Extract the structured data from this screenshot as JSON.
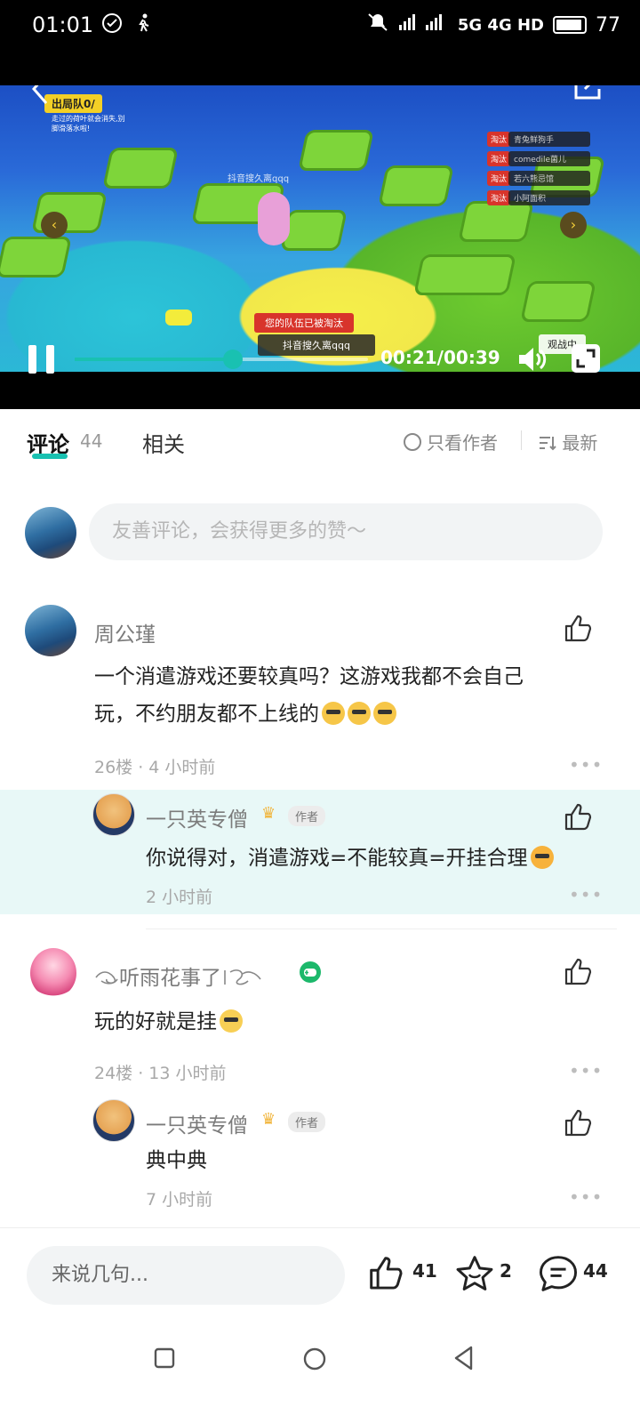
{
  "status_bar": {
    "time": "01:01",
    "network": "5G 4G HD",
    "battery": "77"
  },
  "video": {
    "team_label": "出局队0/",
    "team_note": "走过的荷叶就会消失,别脚滑落水啦!",
    "watermark": "抖音搜久离qqq",
    "eliminated_banner": "您的队伍已被淘汰",
    "search_banner": "抖音搜久离qqq",
    "spectating": "观战中",
    "player_list": [
      {
        "tag": "淘汰",
        "name": "青兔鲜狗手"
      },
      {
        "tag": "淘汰",
        "name": "comedile菌儿"
      },
      {
        "tag": "淘汰",
        "name": "若六熊忌馆"
      },
      {
        "tag": "淘汰",
        "name": "小阿面积"
      }
    ],
    "time_current": "00:21",
    "time_total": "00:39",
    "progress_fraction": 0.54
  },
  "tabs": {
    "comment_label": "评论",
    "comment_count": "44",
    "related_label": "相关",
    "author_only_label": "只看作者",
    "sort_label": "最新"
  },
  "composer": {
    "placeholder": "友善评论，会获得更多的赞～"
  },
  "comments": [
    {
      "name": "周公瑾",
      "text_line1": "一个消遣游戏还要较真吗？这游戏我都不会自己",
      "text_line2": "玩，不约朋友都不上线的",
      "meta": "26楼 · 4 小时前",
      "reply": {
        "name": "一只英专僧",
        "badge": "作者",
        "text": "你说得对，消遣游戏=不能较真=开挂合理",
        "meta": "2 小时前"
      }
    },
    {
      "name": "听雨花事了",
      "text": "玩的好就是挂",
      "meta": "24楼 · 13 小时前",
      "reply": {
        "name": "一只英专僧",
        "badge": "作者",
        "text": "典中典",
        "meta": "7 小时前"
      }
    }
  ],
  "bottom_bar": {
    "input_placeholder": "来说几句...",
    "likes": "41",
    "favorites": "2",
    "comments": "44"
  },
  "colors": {
    "accent": "#19c1b1",
    "reply_bg": "#e8f8f7"
  }
}
